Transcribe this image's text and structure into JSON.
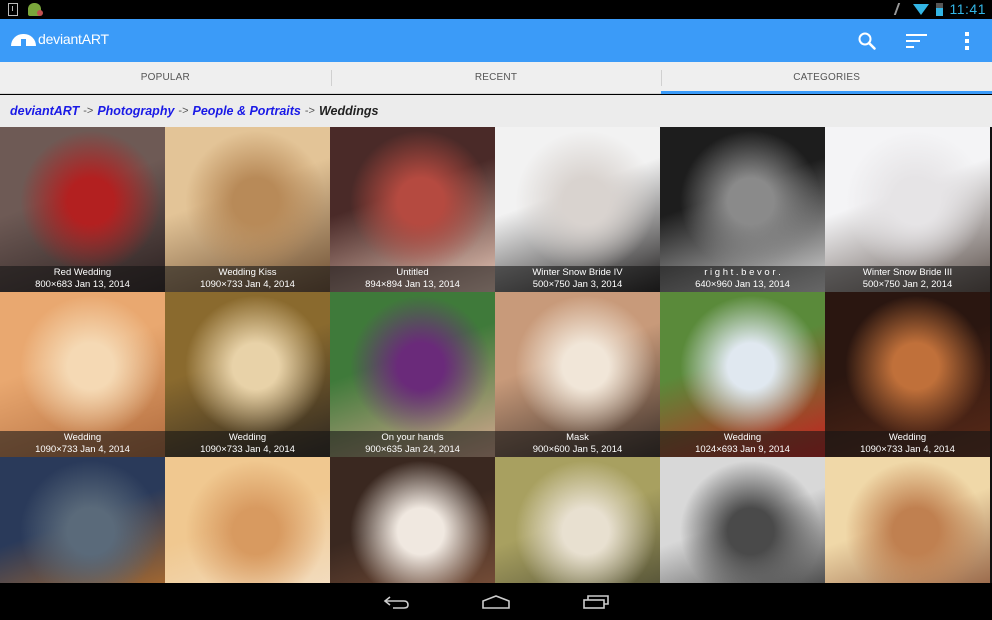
{
  "status_bar": {
    "left_icons": [
      "download-notification-icon",
      "android-debug-icon"
    ],
    "right_icons": [
      "mute-icon",
      "wifi-icon",
      "battery-icon"
    ],
    "time": "11:41"
  },
  "action_bar": {
    "app_name": "deviantART",
    "logo_icon": "deviantart-logo-icon",
    "actions": [
      {
        "name": "search",
        "icon": "search-icon"
      },
      {
        "name": "sort",
        "icon": "sort-icon"
      },
      {
        "name": "overflow",
        "icon": "overflow-menu-icon"
      }
    ],
    "accent_color": "#3b9bf8"
  },
  "tabs": [
    {
      "label": "POPULAR",
      "active": false
    },
    {
      "label": "RECENT",
      "active": false
    },
    {
      "label": "CATEGORIES",
      "active": true
    }
  ],
  "breadcrumb": {
    "items": [
      {
        "label": "deviantART",
        "link": true
      },
      {
        "label": "Photography",
        "link": true
      },
      {
        "label": "People & Portraits",
        "link": true
      },
      {
        "label": "Weddings",
        "link": false
      }
    ],
    "separator": "->"
  },
  "gallery": {
    "items": [
      {
        "title": "Red Wedding",
        "meta": "800×683  Jan 13, 2014",
        "tone": [
          "#6e5a55",
          "#b32020",
          "#2a2020"
        ]
      },
      {
        "title": "Wedding Kiss",
        "meta": "1090×733  Jan 4, 2014",
        "tone": [
          "#e3c497",
          "#b88a58",
          "#6b4d32"
        ]
      },
      {
        "title": "Untitled",
        "meta": "894×894  Jan 13, 2014",
        "tone": [
          "#4a2a28",
          "#b54a40",
          "#e8c8b8"
        ]
      },
      {
        "title": "Winter Snow Bride IV",
        "meta": "500×750  Jan 3, 2014",
        "tone": [
          "#f2f2f2",
          "#d9d3cf",
          "#1c1a1a"
        ]
      },
      {
        "title": "r i g h t . b e v o r .",
        "meta": "640×960  Jan 13, 2014",
        "tone": [
          "#1d1d1d",
          "#8a8a8a",
          "#d8d8d8"
        ]
      },
      {
        "title": "Winter Snow Bride III",
        "meta": "500×750  Jan 2, 2014",
        "tone": [
          "#f4f4f6",
          "#e6e4e6",
          "#5a4e48"
        ]
      },
      {
        "title": "Wedding",
        "meta": "1090×733  Jan 4, 2014",
        "tone": [
          "#e9a870",
          "#f5d9b4",
          "#b06a3c"
        ]
      },
      {
        "title": "Wedding",
        "meta": "1090×733  Jan 4, 2014",
        "tone": [
          "#8a6a2e",
          "#e8d2a8",
          "#2c2620"
        ]
      },
      {
        "title": "On your hands",
        "meta": "900×635  Jan 24, 2014",
        "tone": [
          "#3f7a3a",
          "#6a2a7a",
          "#d6a890"
        ]
      },
      {
        "title": "Mask",
        "meta": "900×600  Jan 5, 2014",
        "tone": [
          "#c89a7a",
          "#f1e6d8",
          "#3a2e28"
        ]
      },
      {
        "title": "Wedding",
        "meta": "1024×693  Jan 9, 2014",
        "tone": [
          "#5a8a3a",
          "#e0e8f0",
          "#c81e1e"
        ]
      },
      {
        "title": "Wedding",
        "meta": "1090×733  Jan 4, 2014",
        "tone": [
          "#2a1610",
          "#c0703a",
          "#5a2a18"
        ]
      },
      {
        "title": "",
        "meta": "",
        "tone": [
          "#2a3a5a",
          "#5a6a7a",
          "#d07820"
        ]
      },
      {
        "title": "",
        "meta": "",
        "tone": [
          "#f0c890",
          "#d89a60",
          "#f4e4d0"
        ]
      },
      {
        "title": "",
        "meta": "",
        "tone": [
          "#3a2820",
          "#f0e8e0",
          "#8a5a40"
        ]
      },
      {
        "title": "",
        "meta": "",
        "tone": [
          "#a8a060",
          "#e8e0d0",
          "#3a3a2a"
        ]
      },
      {
        "title": "",
        "meta": "",
        "tone": [
          "#d8d8d8",
          "#4a4a4a",
          "#1a1a1a"
        ]
      },
      {
        "title": "",
        "meta": "",
        "tone": [
          "#f0d8a8",
          "#c08050",
          "#7a4028"
        ]
      }
    ]
  },
  "nav_bar": {
    "buttons": [
      {
        "name": "back",
        "icon": "back-icon"
      },
      {
        "name": "home",
        "icon": "home-icon"
      },
      {
        "name": "recents",
        "icon": "recent-apps-icon"
      }
    ]
  }
}
